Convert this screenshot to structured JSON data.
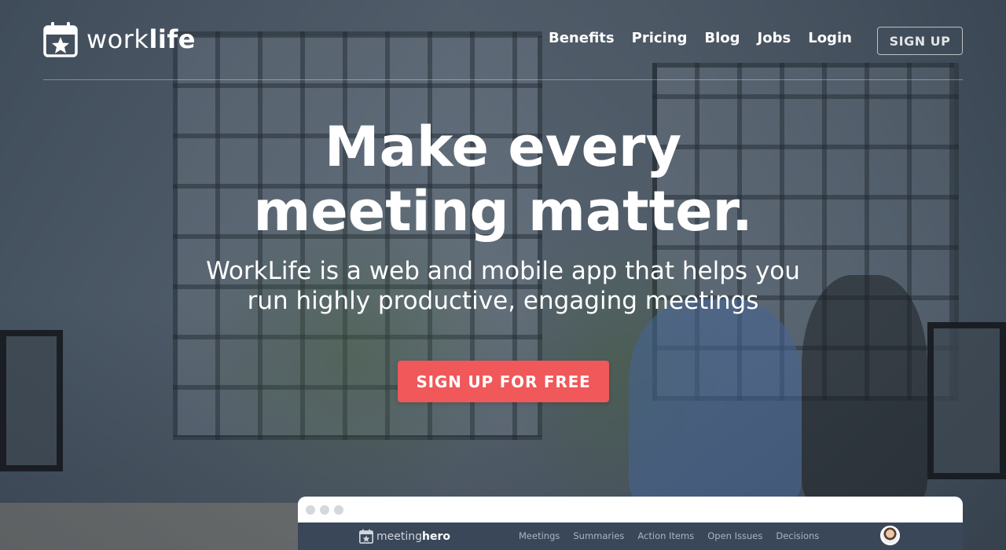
{
  "brand": {
    "name_light": "work",
    "name_bold": "life",
    "icon": "calendar-star-icon"
  },
  "nav": {
    "links": [
      "Benefits",
      "Pricing",
      "Blog",
      "Jobs",
      "Login"
    ],
    "signup_label": "SIGN UP"
  },
  "hero": {
    "headline": "Make every meeting matter.",
    "subhead": "WorkLife is a web and mobile app that helps you run highly productive, engaging meetings",
    "cta_label": "SIGN UP FOR FREE"
  },
  "preview": {
    "brand_light": "meeting",
    "brand_bold": "hero",
    "nav": [
      "Meetings",
      "Summaries",
      "Action Items",
      "Open Issues",
      "Decisions"
    ]
  },
  "colors": {
    "cta": "#f0585a",
    "overlay": "#2d3a4a",
    "app_bar": "#3a4759"
  }
}
